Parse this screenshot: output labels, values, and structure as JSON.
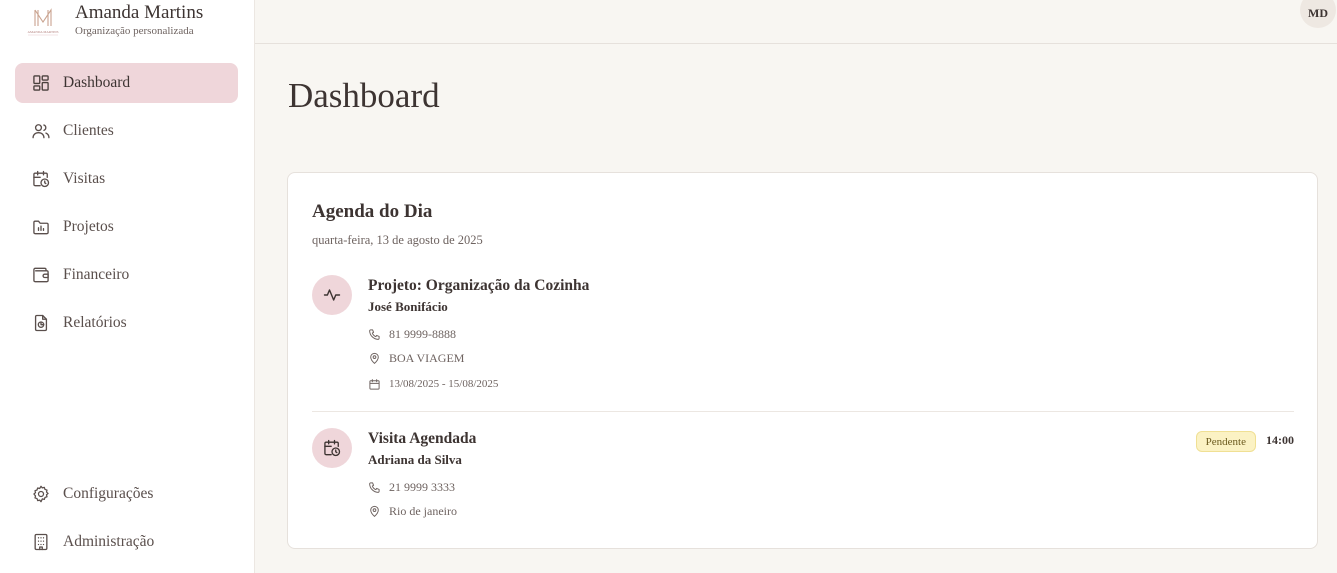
{
  "brand": {
    "name": "Amanda Martins",
    "subtitle": "Organização personalizada",
    "logo_text": "AMANDA MARTINS"
  },
  "sidebar": {
    "items": [
      {
        "label": "Dashboard",
        "icon": "dashboard-grid-icon",
        "active": true
      },
      {
        "label": "Clientes",
        "icon": "users-icon"
      },
      {
        "label": "Visitas",
        "icon": "calendar-clock-icon"
      },
      {
        "label": "Projetos",
        "icon": "folder-chart-icon"
      },
      {
        "label": "Financeiro",
        "icon": "wallet-icon"
      },
      {
        "label": "Relatórios",
        "icon": "file-report-icon"
      }
    ],
    "bottom_items": [
      {
        "label": "Configurações",
        "icon": "gear-icon"
      },
      {
        "label": "Administração",
        "icon": "building-icon"
      }
    ]
  },
  "header": {
    "avatar_initials": "MD"
  },
  "page": {
    "title": "Dashboard"
  },
  "agenda": {
    "title": "Agenda do Dia",
    "date": "quarta-feira, 13 de agosto de 2025",
    "entries": [
      {
        "title": "Projeto: Organização da Cozinha",
        "client": "José Bonifácio",
        "icon": "activity-icon",
        "phone": "81 9999-8888",
        "location": "BOA VIAGEM",
        "period": "13/08/2025 - 15/08/2025"
      },
      {
        "title": "Visita Agendada",
        "client": "Adriana da Silva",
        "icon": "calendar-clock-icon",
        "phone": "21 9999 3333",
        "location": "Rio de janeiro",
        "status": "Pendente",
        "time": "14:00"
      }
    ]
  },
  "colors": {
    "accent": "#efd6da",
    "sidebar_bg": "#ffffff",
    "page_bg": "#f8f6f2",
    "text": "#3d3432",
    "badge_bg": "#fbf2c4"
  }
}
